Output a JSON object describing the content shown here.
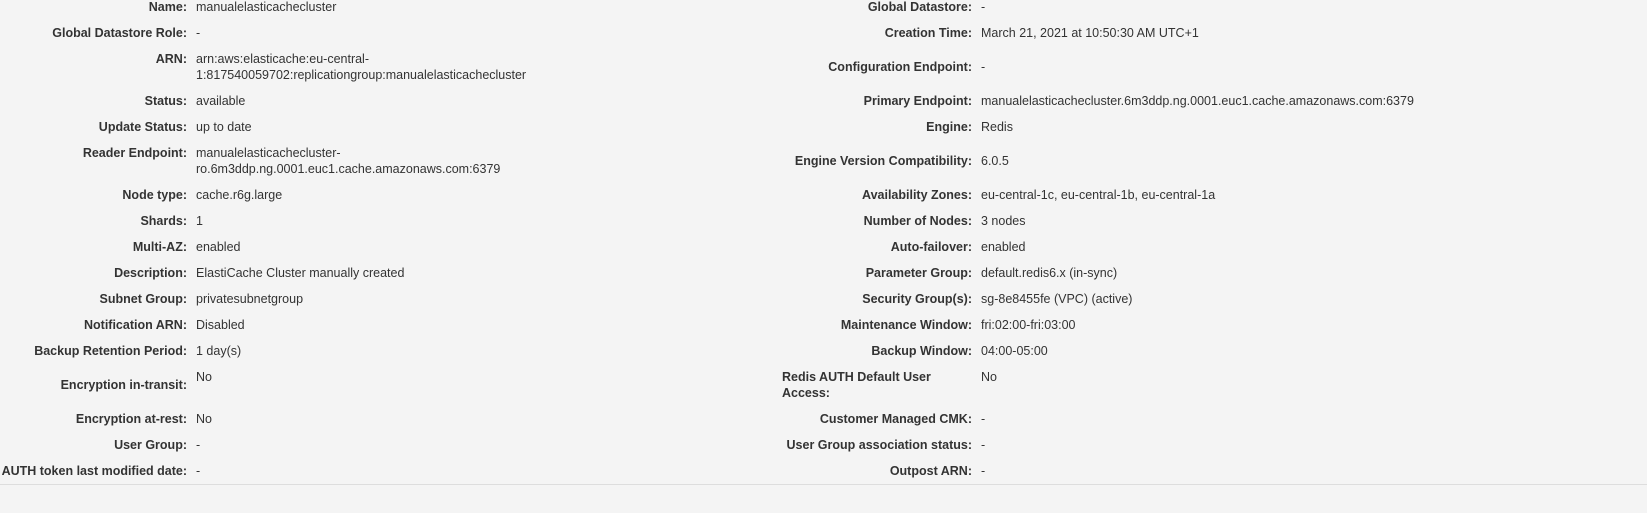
{
  "left": [
    {
      "label": "Name:",
      "value": "manualelasticachecluster"
    },
    {
      "label": "Global Datastore Role:",
      "value": "-"
    },
    {
      "label": "ARN:",
      "value": "arn:aws:elasticache:eu-central-1:817540059702:replicationgroup:manualelasticachecluster"
    },
    {
      "label": "Status:",
      "value": "available"
    },
    {
      "label": "Update Status:",
      "value": "up to date"
    },
    {
      "label": "Reader Endpoint:",
      "value": "manualelasticachecluster-ro.6m3ddp.ng.0001.euc1.cache.amazonaws.com:6379"
    },
    {
      "label": "Node type:",
      "value": "cache.r6g.large"
    },
    {
      "label": "Shards:",
      "value": "1"
    },
    {
      "label": "Multi-AZ:",
      "value": "enabled"
    },
    {
      "label": "Description:",
      "value": "ElastiCache Cluster manually created"
    },
    {
      "label": "Subnet Group:",
      "value": "privatesubnetgroup"
    },
    {
      "label": "Notification ARN:",
      "value": "Disabled"
    },
    {
      "label": "Backup Retention Period:",
      "value": "1 day(s)"
    },
    {
      "label": "Encryption in-transit:",
      "value": "No"
    },
    {
      "label": "Encryption at-rest:",
      "value": "No"
    },
    {
      "label": "User Group:",
      "value": "-"
    },
    {
      "label": "AUTH token last modified date:",
      "value": "-"
    }
  ],
  "right": [
    {
      "label": "Global Datastore:",
      "value": "-"
    },
    {
      "label": "Creation Time:",
      "value": "March 21, 2021 at 10:50:30 AM UTC+1"
    },
    {
      "label": "Configuration Endpoint:",
      "value": "-"
    },
    {
      "label": "Primary Endpoint:",
      "value": "manualelasticachecluster.6m3ddp.ng.0001.euc1.cache.amazonaws.com:6379"
    },
    {
      "label": "Engine:",
      "value": "Redis"
    },
    {
      "label": "Engine Version Compatibility:",
      "value": "6.0.5"
    },
    {
      "label": "Availability Zones:",
      "value": "eu-central-1c, eu-central-1b, eu-central-1a"
    },
    {
      "label": "Number of Nodes:",
      "value": "3 nodes"
    },
    {
      "label": "Auto-failover:",
      "value": "enabled"
    },
    {
      "label": "Parameter Group:",
      "value": "default.redis6.x (in-sync)"
    },
    {
      "label": "Security Group(s):",
      "value": "sg-8e8455fe (VPC) (active)"
    },
    {
      "label": "Maintenance Window:",
      "value": "fri:02:00-fri:03:00"
    },
    {
      "label": "Backup Window:",
      "value": "04:00-05:00"
    },
    {
      "label": "Redis AUTH Default User Access:",
      "value": "No"
    },
    {
      "label": "Customer Managed CMK:",
      "value": "-"
    },
    {
      "label": "User Group association status:",
      "value": "-"
    },
    {
      "label": "Outpost ARN:",
      "value": "-"
    }
  ],
  "colors": {
    "highlight": "#fdfb39",
    "background": "#f4f4f4"
  }
}
